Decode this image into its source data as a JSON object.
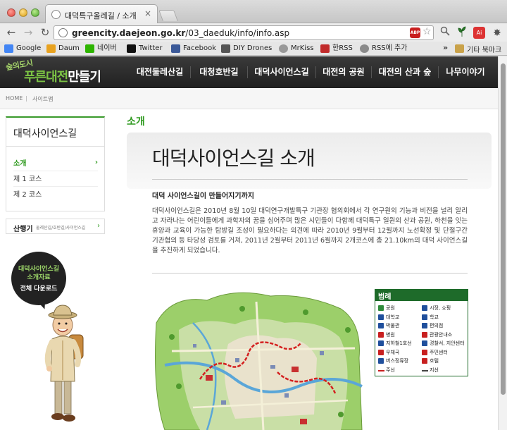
{
  "browser": {
    "tab_title": "대덕특구올레길 / 소개",
    "tab_close": "×",
    "url_host": "greencity.daejeon.go.kr",
    "url_path": "/03_daeduk/info/info.asp",
    "abp_label": "ABP",
    "adobe_label": "Ai",
    "back_glyph": "←",
    "forward_glyph": "→",
    "reload_glyph": "↻",
    "star_glyph": "☆",
    "wrench_glyph": "✸"
  },
  "bookmarks": {
    "items": [
      {
        "label": "Google",
        "color": "#4285f4"
      },
      {
        "label": "Daum",
        "color": "#e8a21f"
      },
      {
        "label": "네이버",
        "color": "#2db400"
      },
      {
        "label": "Twitter",
        "color": "#111111"
      },
      {
        "label": "Facebook",
        "color": "#3b5998"
      },
      {
        "label": "DIY Drones",
        "color": "#555555"
      },
      {
        "label": "MrKiss",
        "color": "#999999"
      },
      {
        "label": "한RSS",
        "color": "#c12b2b"
      },
      {
        "label": "RSS에 추가",
        "color": "#8a8a8a"
      }
    ],
    "overflow": "»",
    "other": "기타 북마크"
  },
  "site": {
    "logo_small": "숲의도시",
    "logo_green": "푸른대전",
    "logo_white": "만들기",
    "nav": [
      "대전둘레산길",
      "대청호반길",
      "대덕사이언스길",
      "대전의 공원",
      "대전의 산과 숲",
      "나무이야기"
    ]
  },
  "breadcrumb": {
    "home": "HOME",
    "sep": "|",
    "current": "사이트맵"
  },
  "sidebar": {
    "title": "대덕사이언스길",
    "items": [
      {
        "label": "소개",
        "active": true,
        "arrow": "›"
      },
      {
        "label": "제 1 코스",
        "active": false
      },
      {
        "label": "제 2 코스",
        "active": false
      }
    ],
    "trail_label": "산행기",
    "trail_sub": "둘레산길/호반길/사이언스길",
    "trail_arrow": "›"
  },
  "promo": {
    "line1": "대덕사이언스길",
    "line2": "소개자료",
    "line3": "전체 다운로드"
  },
  "content": {
    "section_title": "소개",
    "hero_title": "대덕사이언스길 소개",
    "sub_heading": "대덕 사이언스길이 만들어지기까지",
    "body": "대덕사이언스길은 2010년 8월 10일 대덕연구개발특구 기관장 협의회에서 각 연구원의 기능과 비전을 널리 알리고 자라나는 어린이들에게 과학자의 꿈을 심어주며 많은 시민들이 다함께 대덕특구 일원의 산과 공원, 하천을 잇는 휴양과 교육이 가능한 탐방길 조성이 필요하다는 의견에 따라 2010년 9월부터 12월까지 노선확정 및 단절구간 기관협의 등 타당성 검토를 거쳐, 2011년 2월부터 2011년 6월까지 2개코스에 총 21.10km의 대덕 사이언스길을 추진하게 되었습니다."
  },
  "legend": {
    "title": "범례",
    "items": [
      {
        "label": "공원",
        "color": "#2e8b3a"
      },
      {
        "label": "시장, 쇼핑",
        "color": "#1f4f9c"
      },
      {
        "label": "대학교",
        "color": "#1f4f9c"
      },
      {
        "label": "학교",
        "color": "#1f4f9c"
      },
      {
        "label": "박물관",
        "color": "#1f4f9c"
      },
      {
        "label": "편의점",
        "color": "#1f4f9c"
      },
      {
        "label": "병원",
        "color": "#c82020"
      },
      {
        "label": "관광안내소",
        "color": "#c82020"
      },
      {
        "label": "지하철1호선",
        "color": "#1f4f9c"
      },
      {
        "label": "경찰서, 지안센터",
        "color": "#1f4f9c"
      },
      {
        "label": "우체국",
        "color": "#c82020"
      },
      {
        "label": "주민센터",
        "color": "#c82020"
      },
      {
        "label": "버스정류장",
        "color": "#1f4f9c"
      },
      {
        "label": "호텔",
        "color": "#c82020"
      },
      {
        "label": "주선",
        "color": "#c82020",
        "line": true
      },
      {
        "label": "지선",
        "color": "#444444",
        "line": true
      }
    ]
  }
}
